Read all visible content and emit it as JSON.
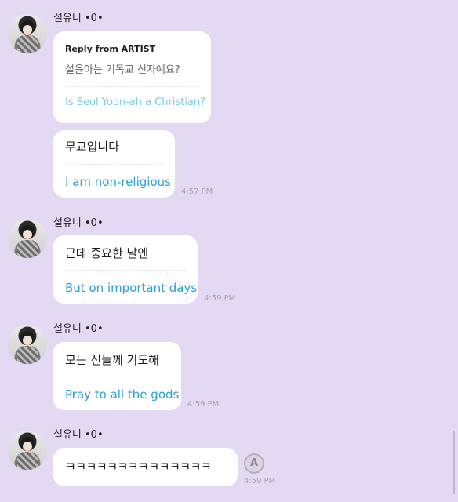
{
  "messages": [
    {
      "sender": "설유니 •0•",
      "reply": {
        "title": "Reply from ARTIST",
        "question": "설윤아는 기독교 신자예요?",
        "question_translation": "Is Seol Yoon-ah a Christian?"
      },
      "text": "무교입니다",
      "translation": "I am non-religious",
      "time": "4:57 PM"
    },
    {
      "sender": "설유니 •0•",
      "text": "근데 중요한 날엔",
      "translation": "But on important days",
      "time": "4:59 PM"
    },
    {
      "sender": "설유니 •0•",
      "text": "모든 신들께 기도해",
      "translation": "Pray to all the gods",
      "time": "4:59 PM"
    },
    {
      "sender": "설유니 •0•",
      "text": "ㅋㅋㅋㅋㅋㅋㅋㅋㅋㅋㅋㅋㅋㅋ",
      "time": "4:59 PM",
      "translate_icon": "translate-icon",
      "translate_glyph": "A"
    }
  ],
  "colors": {
    "background": "#e3d9f2",
    "translation_text": "#2a9fd8",
    "reply_translation_text": "#7ccbe9",
    "timestamp": "#a6a0b0"
  }
}
